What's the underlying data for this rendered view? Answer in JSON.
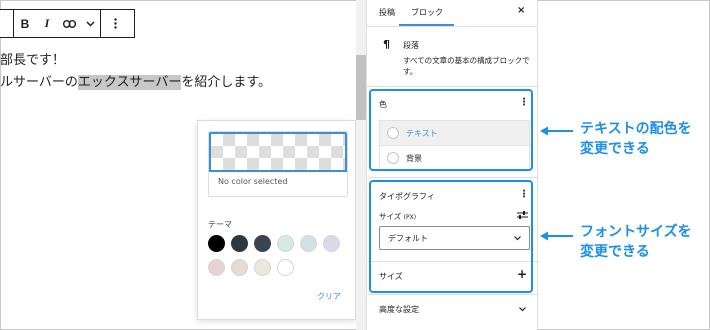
{
  "toolbar": {
    "bold_label": "B",
    "italic_label": "I",
    "link_icon": "link-icon",
    "chevron_icon": "chevron-down-icon",
    "more_icon": "more-vertical-icon"
  },
  "editor": {
    "line1": "部長です！",
    "line2_before": "ルサーバーの",
    "line2_highlight": "エックスサーバー",
    "line2_after": "を紹介します。"
  },
  "color_popover": {
    "no_color_text": "No color selected",
    "theme_label": "テーマ",
    "swatches": [
      "#000000",
      "#2f3842",
      "#3b4550",
      "#d5ebe2",
      "#d3dfe4",
      "#d9d9ea",
      "#e8d3d3",
      "#e6dbd1",
      "#ece8dd",
      "#ffffff"
    ],
    "clear_label": "クリア"
  },
  "sidebar": {
    "tabs": [
      "投稿",
      "ブロック"
    ],
    "close_label": "×",
    "block_icon": "¶",
    "block_title": "段落",
    "block_desc": "すべての文章の基本の構成ブロックです。",
    "color": {
      "title": "色",
      "menu_label": "⋮",
      "items": [
        "テキスト",
        "背景"
      ]
    },
    "typography": {
      "title": "タイポグラフィ",
      "menu_label": "⋮",
      "size_label": "サイズ",
      "size_unit": "(PX)",
      "size_value": "デフォルト",
      "size_section_label": "サイズ",
      "plus_label": "+"
    },
    "advanced_label": "高度な設定"
  },
  "annotations": {
    "color_note_line1": "テキストの配色を",
    "color_note_line2": "変更できる",
    "font_note_line1": "フォントサイズを",
    "font_note_line2": "変更できる"
  },
  "colors": {
    "accent": "#1d8fe8",
    "link_blue": "#3a8fd8",
    "highlight": "#c7c7c7"
  }
}
